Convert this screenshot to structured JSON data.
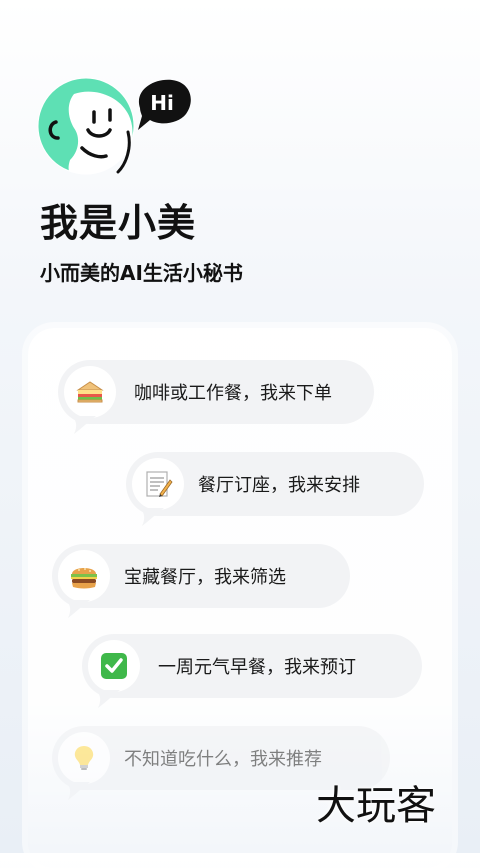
{
  "hero": {
    "hi_text": "Hi",
    "headline": "我是小美",
    "subline": "小而美的AI生活小秘书"
  },
  "colors": {
    "avatar_green": "#5ee0b4",
    "bubble_bg": "#f2f3f5",
    "text_dark": "#111111"
  },
  "features": [
    {
      "icon": "sandwich-icon",
      "text": "咖啡或工作餐，我来下单"
    },
    {
      "icon": "memo-icon",
      "text": "餐厅订座，我来安排"
    },
    {
      "icon": "hamburger-icon",
      "text": "宝藏餐厅，我来筛选"
    },
    {
      "icon": "check-mark-button-icon",
      "text": "一周元气早餐，我来预订"
    },
    {
      "icon": "light-bulb-icon",
      "text": "不知道吃什么，我来推荐"
    }
  ],
  "watermark": "大玩客"
}
